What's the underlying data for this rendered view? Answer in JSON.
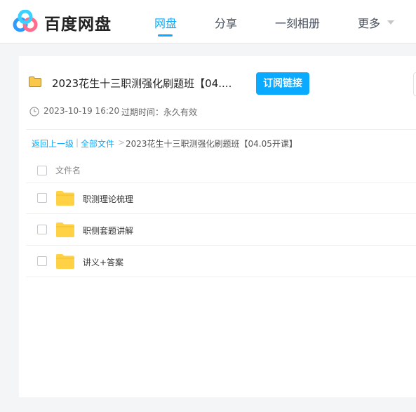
{
  "brand": {
    "name": "百度网盘"
  },
  "nav": {
    "items": [
      "网盘",
      "分享",
      "一刻相册",
      "更多"
    ],
    "active": 0
  },
  "share": {
    "title": "2023花生十三职测强化刷题班【04....",
    "subscribe_label": "订阅链接",
    "date": "2023-10-19 16:20",
    "expire_label": "过期时间：",
    "expire_value": "永久有效"
  },
  "breadcrumb": {
    "back": "返回上一级",
    "separator": "|",
    "all_files": "全部文件",
    "arrow": ">",
    "current": "2023花生十三职测强化刷题班【04.05开课】"
  },
  "list": {
    "header": "文件名",
    "files": [
      "职测理论梳理",
      "职侧套题讲解",
      "讲义+答案"
    ]
  },
  "colors": {
    "accent": "#09aaff",
    "folder": "#ffd145"
  }
}
